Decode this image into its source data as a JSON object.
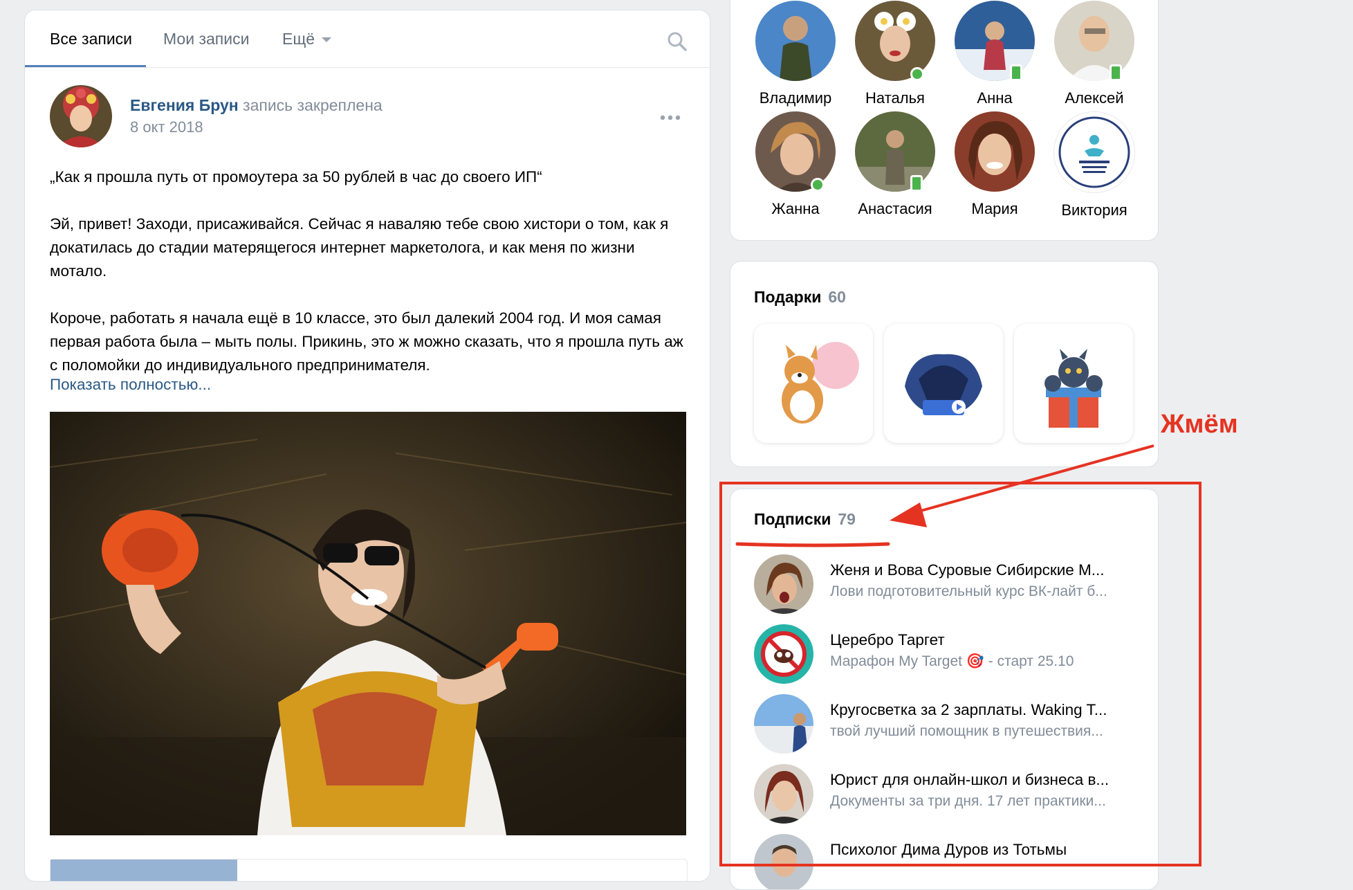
{
  "tabs": [
    {
      "label": "Все записи"
    },
    {
      "label": "Мои записи"
    },
    {
      "label": "Ещё"
    }
  ],
  "post": {
    "author": "Евгения Брун",
    "pinned_label": "запись закреплена",
    "date": "8 окт 2018",
    "paragraphs": [
      "„Как я прошла путь от промоутера за 50 рублей в час до своего ИП“",
      "Эй, привет! Заходи, присаживайся. Сейчас я наваляю тебе свою хистори о том, как я докатилась до стадии матерящегося интернет маркетолога, и как меня по жизни мотало.",
      "Короче, работать я начала ещё в 10 классе, это был далекий 2004 год. И моя самая первая работа была – мыть полы. Прикинь, это ж можно сказать, что я прошла путь аж с поломойки до индивидуального предпринимателя."
    ],
    "show_more": "Показать полностью..."
  },
  "friends": [
    {
      "name": "Владимир",
      "status": "none"
    },
    {
      "name": "Наталья",
      "status": "online"
    },
    {
      "name": "Анна",
      "status": "mobile"
    },
    {
      "name": "Алексей",
      "status": "mobile"
    },
    {
      "name": "Жанна",
      "status": "online"
    },
    {
      "name": "Анастасия",
      "status": "mobile"
    },
    {
      "name": "Мария",
      "status": "none"
    },
    {
      "name": "Виктория",
      "status": "none"
    }
  ],
  "gifts": {
    "title": "Подарки",
    "count": "60"
  },
  "subscriptions": {
    "title": "Подписки",
    "count": "79",
    "items": [
      {
        "title": "Женя и Вова Суровые Сибирские М...",
        "subtitle": "Лови подготовительный курс ВК-лайт б..."
      },
      {
        "title": "Церебро Таргет",
        "subtitle": "Марафон My Target 🎯 - старт 25.10"
      },
      {
        "title": "Кругосветка за 2 зарплаты. Waking T...",
        "subtitle": "твой лучший помощник в путешествия..."
      },
      {
        "title": "Юрист для онлайн-школ и бизнеса в...",
        "subtitle": "Документы за три дня. 17 лет практики..."
      },
      {
        "title": "Психолог Дима Дуров из Тотьмы",
        "subtitle": ""
      }
    ]
  },
  "annotation": {
    "label": "Жмём",
    "color": "#e53322"
  },
  "colors": {
    "link": "#2a5885",
    "muted": "#818c99",
    "accent": "#5181b8",
    "online": "#4bb34b"
  }
}
